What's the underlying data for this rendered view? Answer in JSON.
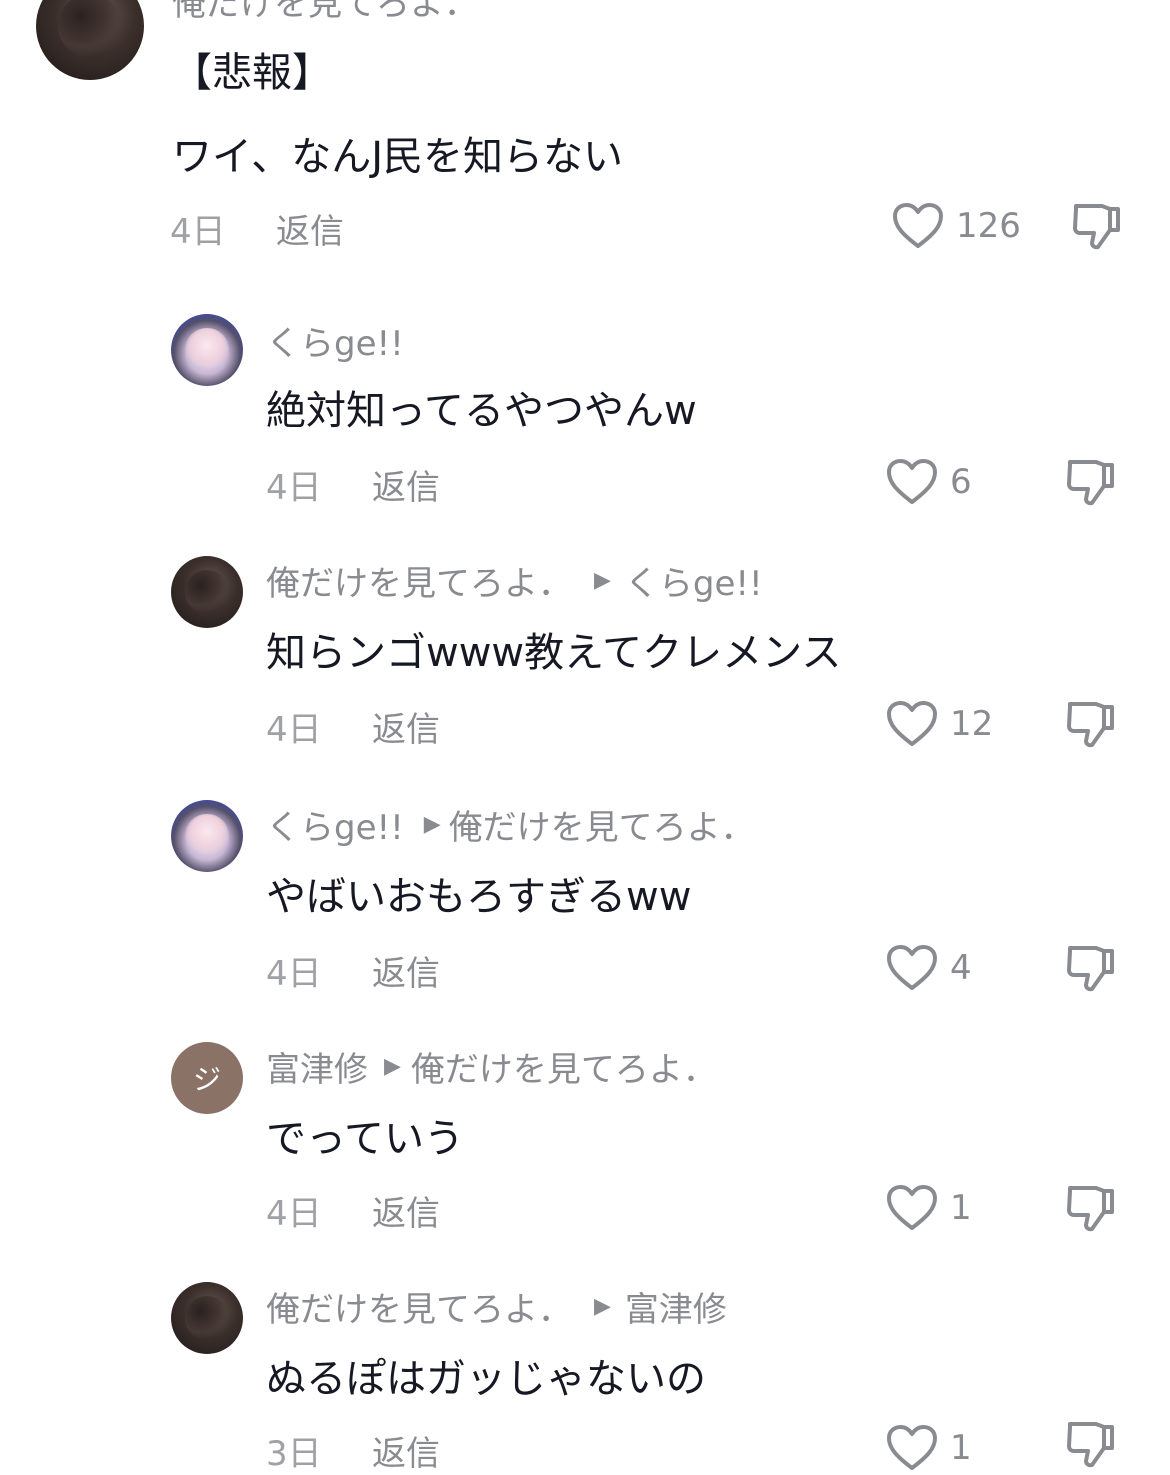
{
  "comments": [
    {
      "username_partial": "俺だけを見てろよ．",
      "heading": "【悲報】",
      "text": "ワイ、なんJ民を知らない",
      "time": "4日",
      "reply_label": "返信",
      "likes": "126"
    },
    {
      "username": "くらge!!",
      "reply_to": "",
      "text": "絶対知ってるやつやんw",
      "time": "4日",
      "reply_label": "返信",
      "likes": "6"
    },
    {
      "username": "俺だけを見てろよ．",
      "reply_to": "くらge!!",
      "text": "知らンゴwww教えてクレメンス",
      "time": "4日",
      "reply_label": "返信",
      "likes": "12"
    },
    {
      "username": "くらge!!",
      "reply_to": "俺だけを見てろよ．",
      "text": "やばいおもろすぎるww",
      "time": "4日",
      "reply_label": "返信",
      "likes": "4"
    },
    {
      "username": "富津修",
      "avatar_letter": "ジ",
      "reply_to": "俺だけを見てろよ．",
      "text": "でっていう",
      "time": "4日",
      "reply_label": "返信",
      "likes": "1"
    },
    {
      "username": "俺だけを見てろよ．",
      "reply_to": "富津修",
      "text": "ぬるぽはガッじゃないの",
      "time": "3日",
      "reply_label": "返信",
      "likes": "1"
    }
  ],
  "icons": {
    "like": "heart-outline-icon",
    "dislike": "thumbs-down-outline-icon",
    "reply_to": "triangle-right-icon"
  },
  "colors": {
    "text": "#161823",
    "muted": "#8a8b91",
    "time": "#a0a1a6"
  }
}
